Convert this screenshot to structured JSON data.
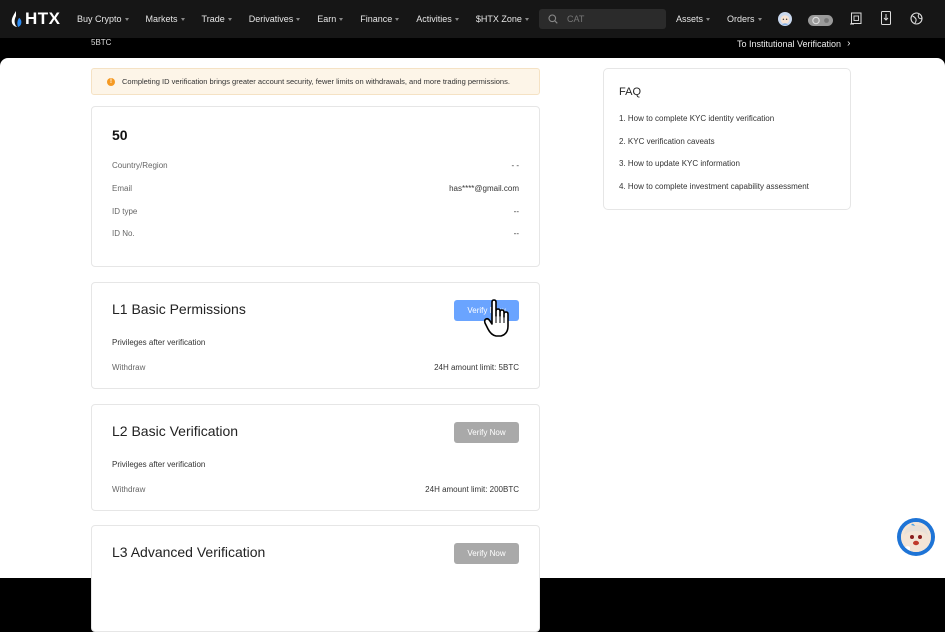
{
  "header": {
    "logo_text": "HTX",
    "nav_items": [
      {
        "label": "Buy Crypto"
      },
      {
        "label": "Markets"
      },
      {
        "label": "Trade"
      },
      {
        "label": "Derivatives"
      },
      {
        "label": "Earn"
      },
      {
        "label": "Finance"
      },
      {
        "label": "Activities"
      },
      {
        "label": "$HTX Zone"
      }
    ],
    "search": {
      "placeholder": "CAT",
      "value": ""
    },
    "right_items": [
      {
        "label": "Assets"
      },
      {
        "label": "Orders"
      }
    ],
    "icons": [
      "avatar-icon",
      "toggle-icon",
      "notes-icon",
      "download-icon",
      "language-icon"
    ],
    "toggle_count": "0"
  },
  "subbar": {
    "left_text": "5BTC",
    "right_link": "To Institutional Verification",
    "right_chevron": "›"
  },
  "notice": {
    "icon": "!",
    "text": "Completing ID verification brings greater account security, fewer limits on withdrawals, and more trading permissions."
  },
  "profile": {
    "uid": "50",
    "rows": [
      {
        "label": "Country/Region",
        "value": "- -"
      },
      {
        "label": "Email",
        "value": "has****@gmail.com"
      },
      {
        "label": "ID type",
        "value": "--"
      },
      {
        "label": "ID No.",
        "value": "--"
      }
    ]
  },
  "levels": [
    {
      "title": "L1 Basic Permissions",
      "button": "Verify Now",
      "privileges": "Privileges after verification",
      "withdraw_label": "Withdraw",
      "withdraw_value": "24H amount limit: 5BTC",
      "state": "active"
    },
    {
      "title": "L2 Basic Verification",
      "button": "Verify Now",
      "privileges": "Privileges after verification",
      "withdraw_label": "Withdraw",
      "withdraw_value": "24H amount limit: 200BTC",
      "state": "disabled"
    },
    {
      "title": "L3 Advanced Verification",
      "button": "Verify Now",
      "state": "disabled"
    }
  ],
  "faq": {
    "title": "FAQ",
    "items": [
      "1. How to complete KYC identity verification",
      "2. KYC verification caveats",
      "3. How to update KYC information",
      "4. How to complete investment capability assessment"
    ]
  },
  "colors": {
    "primary_button": "#6aa4ff",
    "disabled_button": "#a9a9a9",
    "notice_bg": "#fdf5e8",
    "warn": "#f59a23",
    "topbar_bg": "#161616"
  }
}
